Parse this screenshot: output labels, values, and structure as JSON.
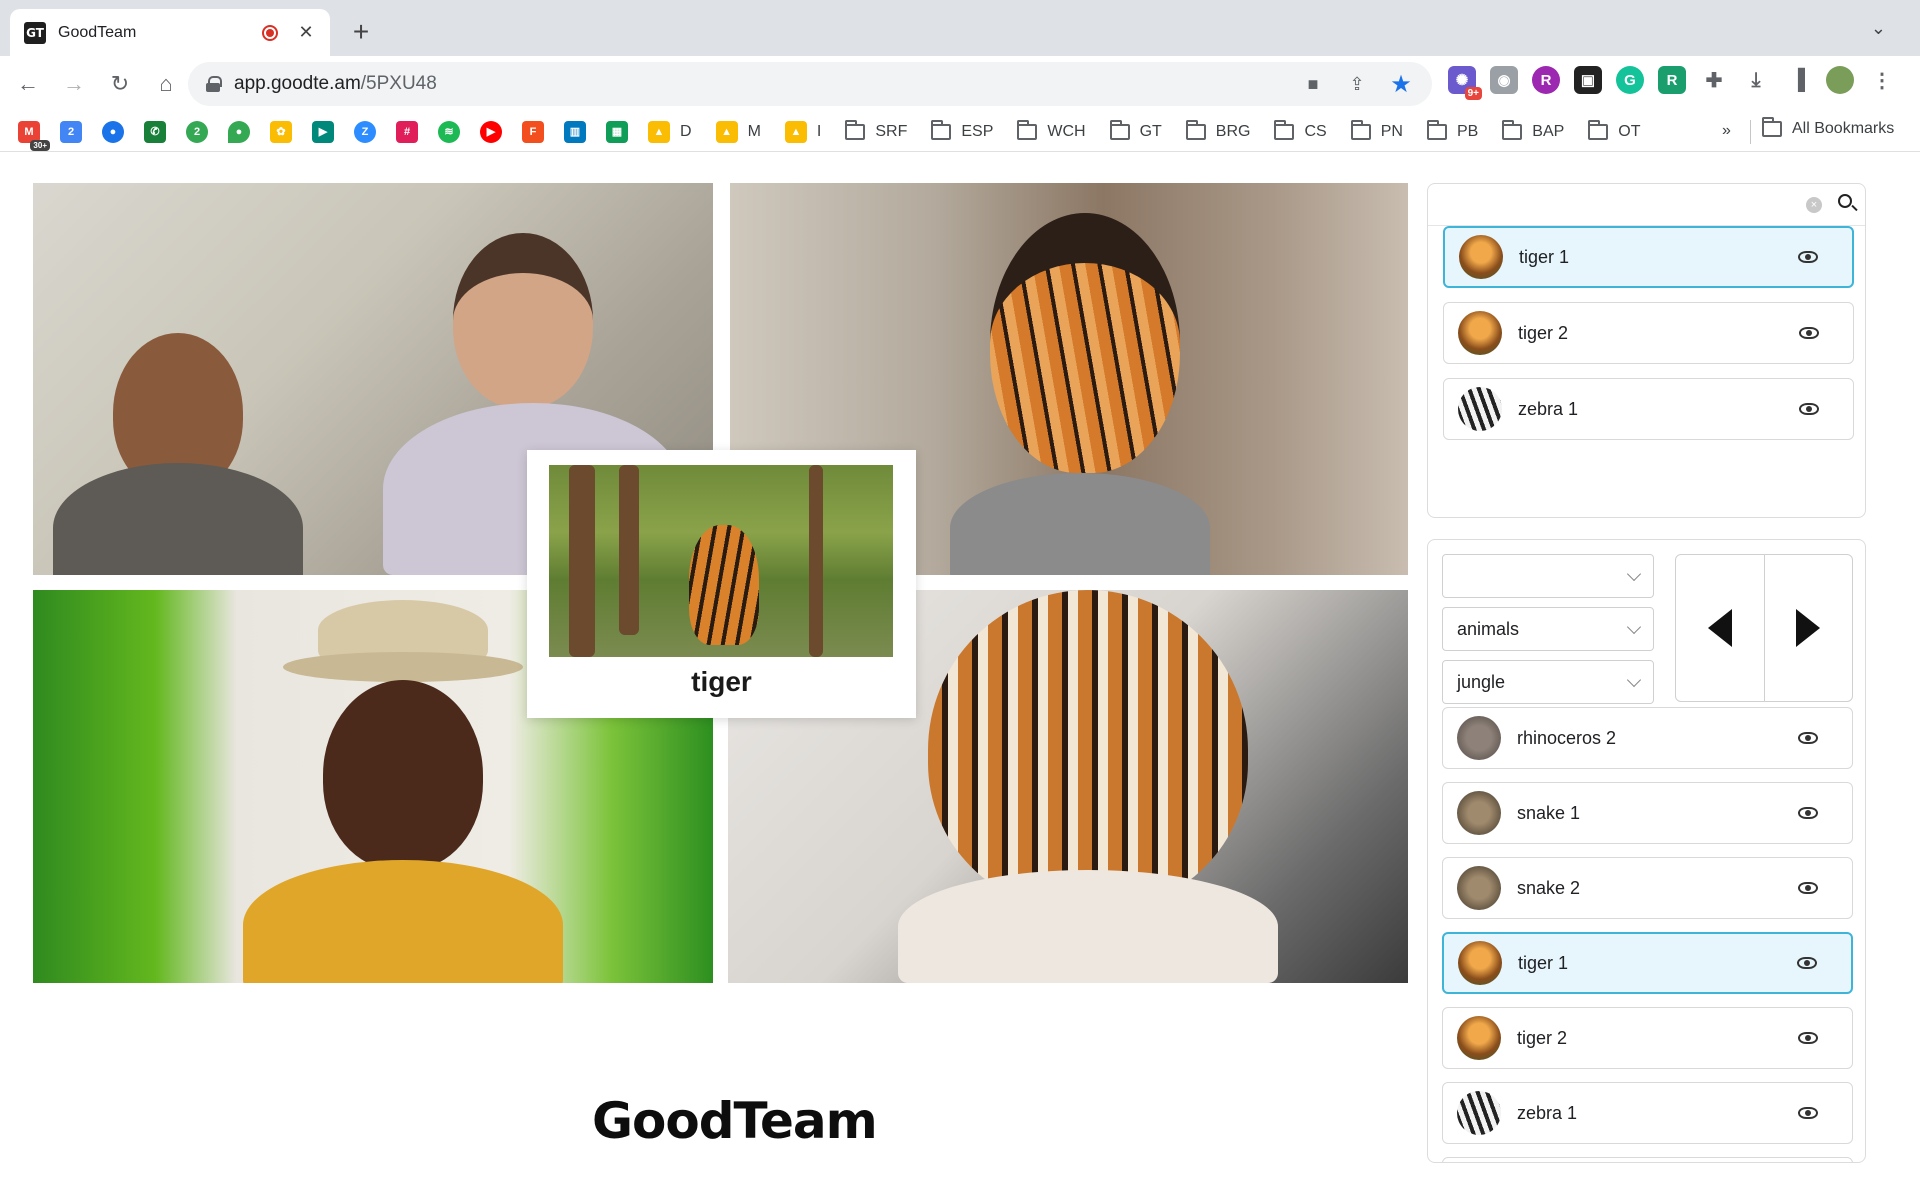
{
  "browser": {
    "tab_title": "GoodTeam",
    "tab_favicon": "GT",
    "new_tab_label": "+",
    "url_host": "app.goodte.am",
    "url_path": "/5PXU48",
    "extension_badge": "9+",
    "bookmarks": {
      "text_items": [
        "D",
        "M",
        "I"
      ],
      "folders": [
        "SRF",
        "ESP",
        "WCH",
        "GT",
        "BRG",
        "CS",
        "PN",
        "PB",
        "BAP",
        "OT"
      ],
      "overflow": "»",
      "all_label": "All Bookmarks"
    },
    "gmail_badge": "30+",
    "calendar_day": "2",
    "chat_badge": "2"
  },
  "meeting": {
    "caption_card": {
      "label": "tiger"
    },
    "brand": "GoodTeam"
  },
  "effects_panel": {
    "search_placeholder": "",
    "items": [
      {
        "label": "tiger 1",
        "thumb": "tiger",
        "selected": true
      },
      {
        "label": "tiger 2",
        "thumb": "tiger",
        "selected": false
      },
      {
        "label": "zebra 1",
        "thumb": "zebra",
        "selected": false
      }
    ]
  },
  "library_panel": {
    "select_1": "",
    "select_2": "animals",
    "select_3": "jungle",
    "items": [
      {
        "label": "rhinoceros 2",
        "thumb": "rhino",
        "selected": false
      },
      {
        "label": "snake 1",
        "thumb": "snake",
        "selected": false
      },
      {
        "label": "snake 2",
        "thumb": "snake",
        "selected": false
      },
      {
        "label": "tiger 1",
        "thumb": "tiger",
        "selected": true
      },
      {
        "label": "tiger 2",
        "thumb": "tiger",
        "selected": false
      },
      {
        "label": "zebra 1",
        "thumb": "zebra",
        "selected": false
      }
    ]
  },
  "colors": {
    "selected_bg": "#e6f6fc",
    "selected_border": "#3fb4d9",
    "accent_blue": "#1a73e8"
  }
}
